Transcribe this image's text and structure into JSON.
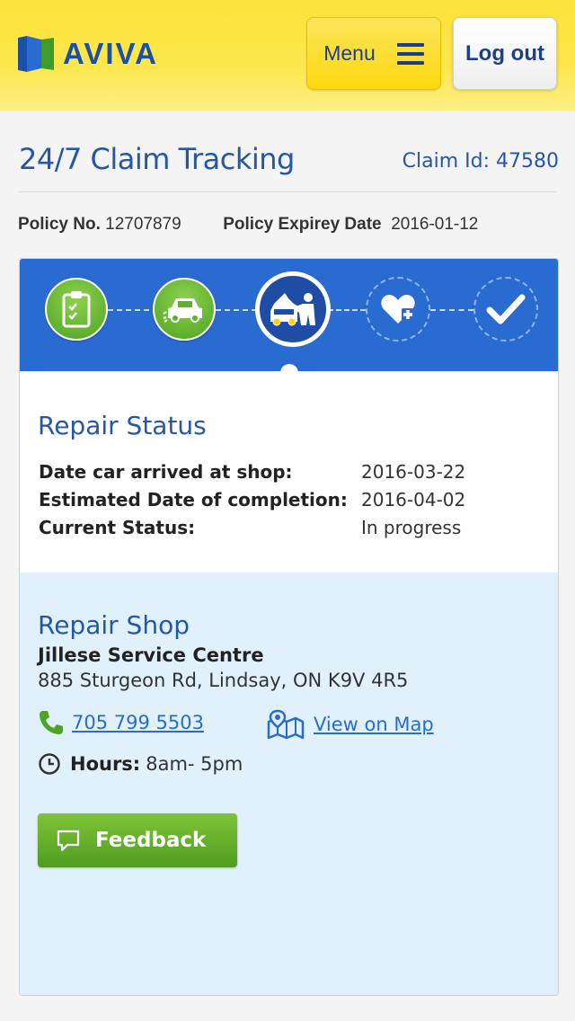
{
  "header": {
    "brand": "AVIVA",
    "menu_label": "Menu",
    "logout_label": "Log out",
    "brand_colors": {
      "blue": "#1b4fa8",
      "yellow": "#fde23a",
      "green": "#3e9a2a"
    }
  },
  "page": {
    "title": "24/7 Claim Tracking",
    "claim_id_label": "Claim Id:",
    "claim_id": "47580"
  },
  "policy": {
    "number_label": "Policy No.",
    "number": "12707879",
    "expiry_label": "Policy Expirey Date",
    "expiry": "2016-01-12"
  },
  "progress": {
    "steps": [
      {
        "icon": "clipboard-check-icon",
        "state": "done"
      },
      {
        "icon": "car-accident-icon",
        "state": "done"
      },
      {
        "icon": "car-repair-icon",
        "state": "current"
      },
      {
        "icon": "heart-plus-icon",
        "state": "pending"
      },
      {
        "icon": "checkmark-icon",
        "state": "pending"
      }
    ],
    "colors": {
      "bar": "#2a6bd2",
      "done": "#5fb02a",
      "current": "#1f4da5"
    }
  },
  "repair_status": {
    "title": "Repair Status",
    "rows": [
      {
        "label": "Date car arrived at shop:",
        "value": "2016-03-22"
      },
      {
        "label": "Estimated Date of completion:",
        "value": "2016-04-02"
      },
      {
        "label": "Current Status:",
        "value": "In progress"
      }
    ]
  },
  "repair_shop": {
    "title": "Repair Shop",
    "name": "Jillese Service Centre",
    "address": "885 Sturgeon Rd, Lindsay, ON K9V 4R5",
    "phone": "705 799 5503",
    "map_link": "View on Map",
    "hours_label": "Hours:",
    "hours": "8am- 5pm"
  },
  "feedback": {
    "label": "Feedback"
  }
}
